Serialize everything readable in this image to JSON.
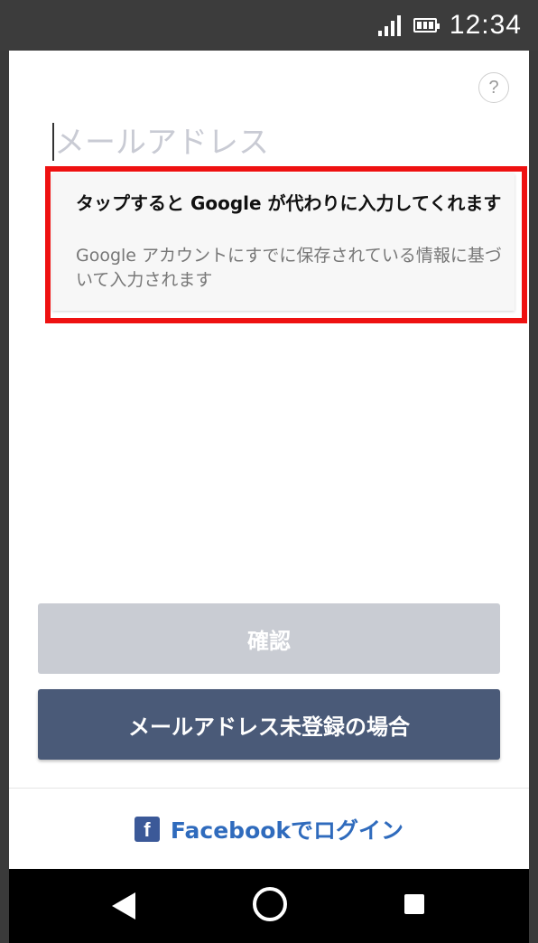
{
  "status_bar": {
    "time": "12:34",
    "icons": [
      "signal-icon",
      "battery-icon"
    ]
  },
  "header": {
    "help_icon_label": "?"
  },
  "email": {
    "placeholder": "メールアドレス",
    "value": ""
  },
  "autofill": {
    "title": "タップすると Google が代わりに入力してくれます",
    "description": "Google アカウントにすでに保存されている情報に基づいて入力されます"
  },
  "actions": {
    "confirm_label": "確認",
    "register_label": "メールアドレス未登録の場合"
  },
  "facebook": {
    "icon_letter": "f",
    "label": "Facebookでログイン"
  },
  "colors": {
    "highlight": "#ee1111",
    "primary_button": "#4a5a78",
    "disabled_button": "#c9ccd3",
    "facebook_blue": "#3b5998",
    "link_blue": "#2f6bbd"
  },
  "nav_bar": {
    "icons": [
      "back-icon",
      "home-icon",
      "recents-icon"
    ]
  }
}
